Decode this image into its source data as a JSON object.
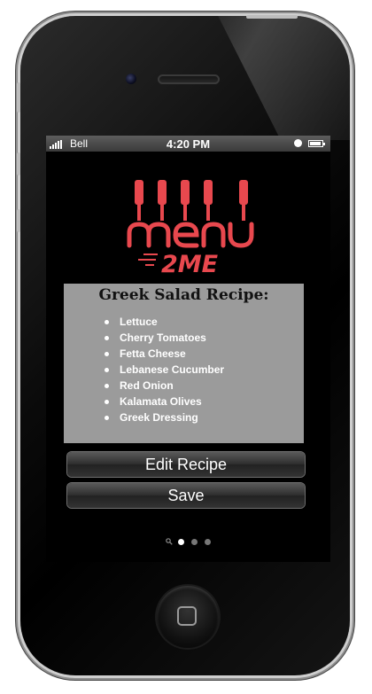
{
  "status_bar": {
    "carrier": "Bell",
    "time": "4:20 PM"
  },
  "logo": {
    "brand_line_1": "menu",
    "brand_line_2": "2ME",
    "color": "#e8484e"
  },
  "recipe": {
    "title": "Greek Salad Recipe:",
    "ingredients": [
      "Lettuce",
      "Cherry Tomatoes",
      "Fetta Cheese",
      "Lebanese Cucumber",
      "Red Onion",
      "Kalamata Olives",
      "Greek Dressing"
    ]
  },
  "actions": {
    "edit_label": "Edit Recipe",
    "save_label": "Save"
  },
  "pager": {
    "pages": 3,
    "active_index": 0,
    "search_icon": "magnifier-icon"
  },
  "colors": {
    "card_background": "#9b9b9b",
    "screen_background": "#000000",
    "accent": "#e8484e"
  }
}
